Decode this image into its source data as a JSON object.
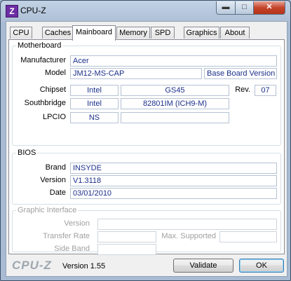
{
  "window": {
    "title": "CPU-Z",
    "icon_letter": "Z"
  },
  "tabs": [
    "CPU",
    "Caches",
    "Mainboard",
    "Memory",
    "SPD",
    "Graphics",
    "About"
  ],
  "motherboard": {
    "legend": "Motherboard",
    "manufacturer_label": "Manufacturer",
    "manufacturer": "Acer",
    "model_label": "Model",
    "model": "JM12-MS-CAP",
    "model_extra": "Base Board Version",
    "chipset_label": "Chipset",
    "chipset_vendor": "Intel",
    "chipset_name": "GS45",
    "rev_label": "Rev.",
    "rev": "07",
    "southbridge_label": "Southbridge",
    "southbridge_vendor": "Intel",
    "southbridge_name": "82801IM (ICH9-M)",
    "lpcio_label": "LPCIO",
    "lpcio": "NS",
    "lpcio_extra": ""
  },
  "bios": {
    "legend": "BIOS",
    "brand_label": "Brand",
    "brand": "INSYDE",
    "version_label": "Version",
    "version": "V1.3118",
    "date_label": "Date",
    "date": "03/01/2010"
  },
  "graphic_interface": {
    "legend": "Graphic Interface",
    "version_label": "Version",
    "version": "",
    "transfer_rate_label": "Transfer Rate",
    "transfer_rate": "",
    "max_supported_label": "Max. Supported",
    "max_supported": "",
    "side_band_label": "Side Band",
    "side_band": ""
  },
  "footer": {
    "brand": "CPU-Z",
    "version": "Version 1.55",
    "validate": "Validate",
    "ok": "OK"
  }
}
